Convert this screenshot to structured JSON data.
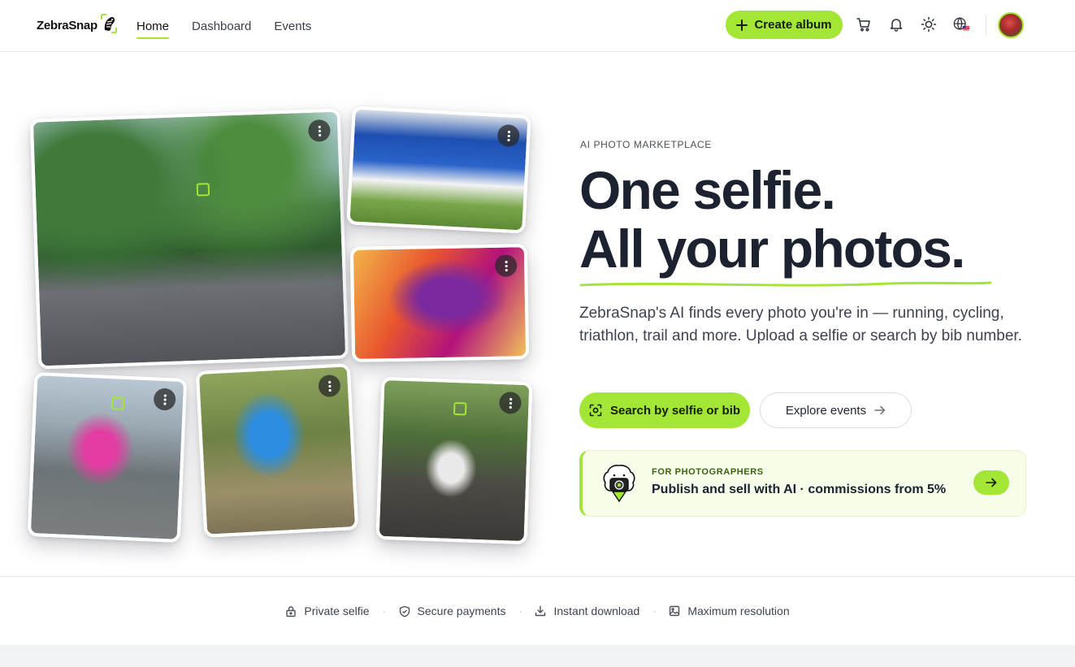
{
  "brand": {
    "name": "ZebraSnap"
  },
  "nav": {
    "items": [
      {
        "label": "Home",
        "active": true
      },
      {
        "label": "Dashboard",
        "active": false
      },
      {
        "label": "Events",
        "active": false
      }
    ]
  },
  "header": {
    "create_label": "Create album",
    "icons": [
      "cart-icon",
      "bell-icon",
      "sun-icon",
      "globe-icon"
    ]
  },
  "hero": {
    "eyebrow": "AI PHOTO MARKETPLACE",
    "headline_line1": "One selfie.",
    "headline_line2": "All your photos.",
    "lead": "ZebraSnap's AI finds every photo you're in — running, cycling, triathlon, trail and more. Upload a selfie or search by bib number.",
    "primary_cta": "Search by selfie or bib",
    "secondary_cta": "Explore events"
  },
  "promo": {
    "eyebrow": "FOR PHOTOGRAPHERS",
    "title": "Publish and sell with AI · commissions from 5%"
  },
  "trust": [
    {
      "label": "Private selfie",
      "icon": "lock-icon"
    },
    {
      "label": "Secure payments",
      "icon": "shield-check-icon"
    },
    {
      "label": "Instant download",
      "icon": "download-icon"
    },
    {
      "label": "Maximum resolution",
      "icon": "image-icon"
    }
  ],
  "colors": {
    "accent": "#a3e635",
    "text": "#1c2230",
    "promo_bg": "#f6fde9"
  }
}
